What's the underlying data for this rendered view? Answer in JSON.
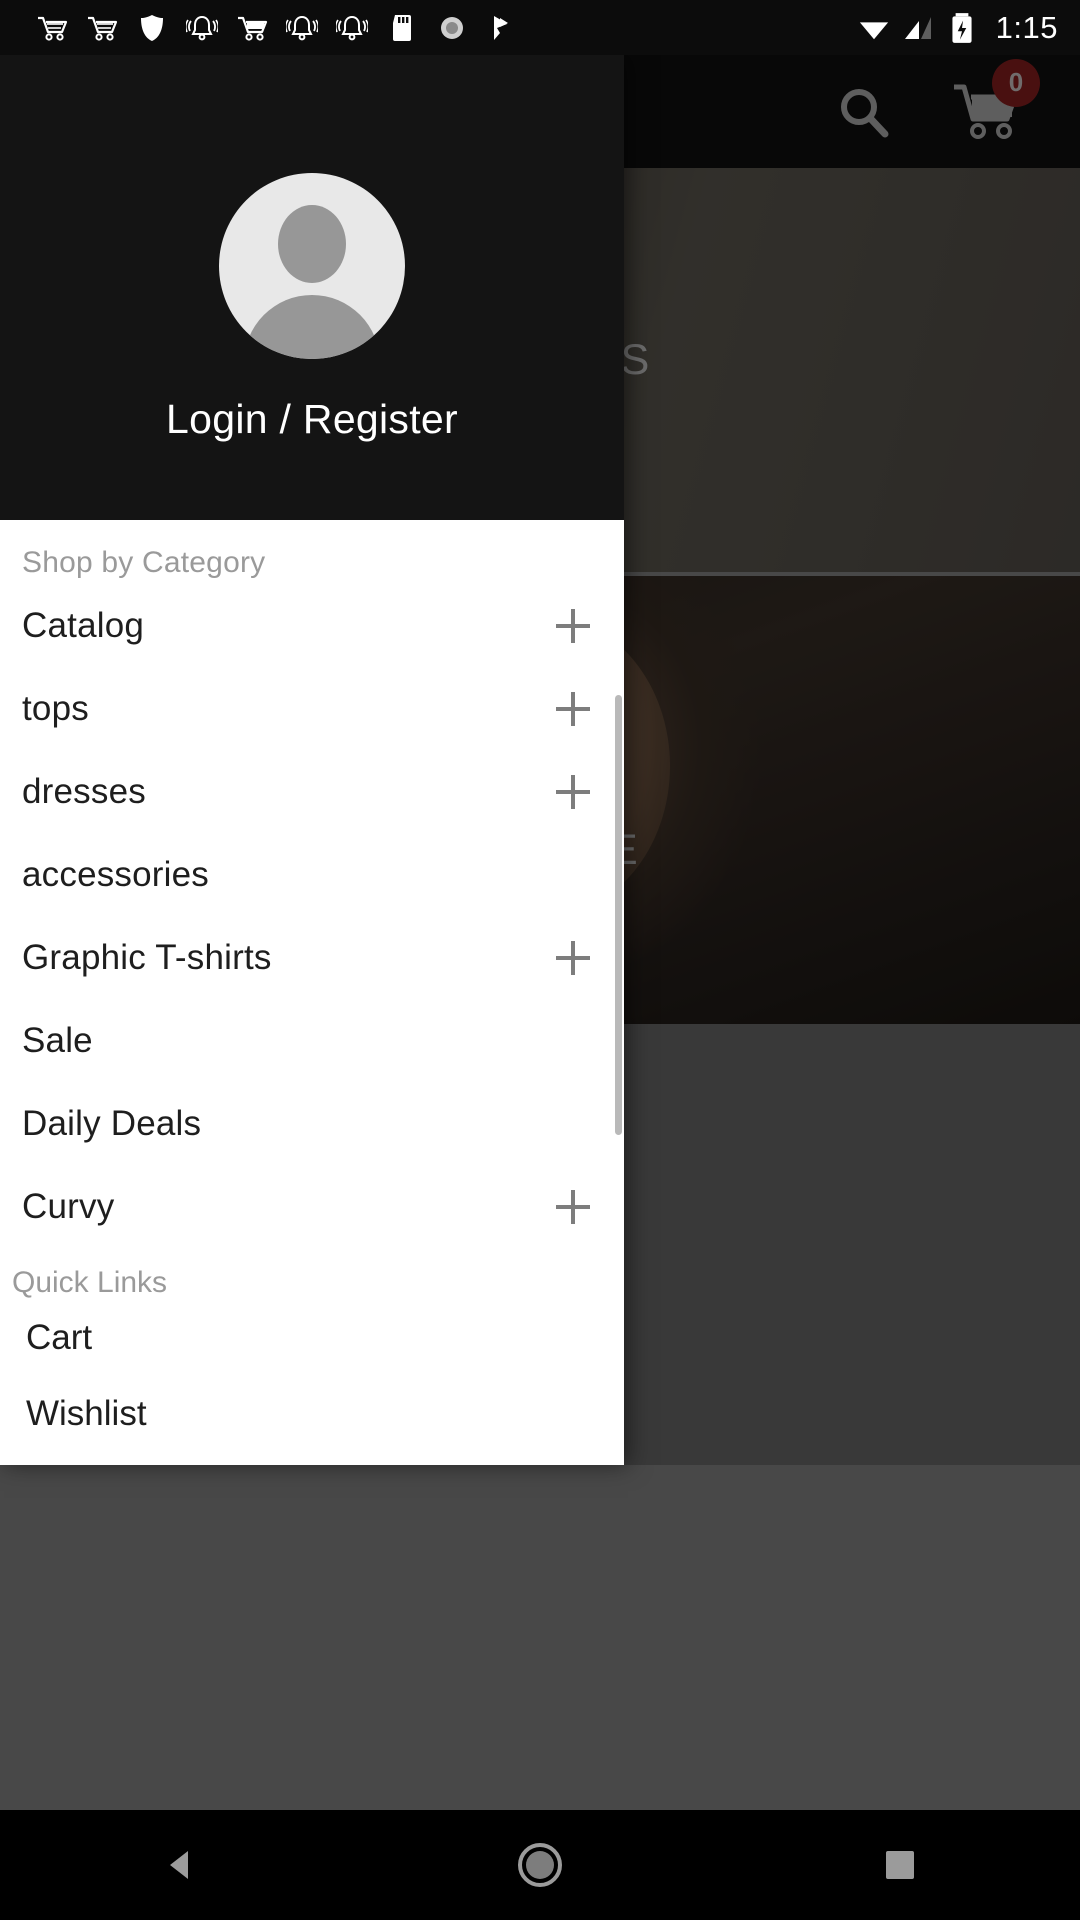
{
  "status_bar": {
    "time": "1:15",
    "left_icons": [
      {
        "name": "cart-notification-icon-1",
        "glyph": "cart"
      },
      {
        "name": "cart-notification-icon-2",
        "glyph": "cart"
      },
      {
        "name": "shield-icon",
        "glyph": "shield"
      },
      {
        "name": "alarm-ringing-icon-1",
        "glyph": "bell"
      },
      {
        "name": "cart-notification-icon-3",
        "glyph": "cart"
      },
      {
        "name": "alarm-ringing-icon-2",
        "glyph": "bell"
      },
      {
        "name": "alarm-ringing-icon-3",
        "glyph": "bell"
      },
      {
        "name": "sd-card-icon",
        "glyph": "sdcard"
      },
      {
        "name": "sync-circle-icon",
        "glyph": "sync"
      },
      {
        "name": "checkmark-flag-icon",
        "glyph": "flagcheck"
      }
    ],
    "right_icons": [
      {
        "name": "wifi-icon",
        "glyph": "wifi"
      },
      {
        "name": "cellular-signal-icon",
        "glyph": "signal"
      },
      {
        "name": "battery-charging-icon",
        "glyph": "battery"
      }
    ]
  },
  "app_bar": {
    "search_label": "search-icon",
    "cart_label": "shopping-cart-icon",
    "cart_badge_count": "0",
    "badge_color": "#8d2020"
  },
  "background_content": {
    "banner_1_caption": "ARRIVALS",
    "banner_2_caption": "T CHACE"
  },
  "drawer": {
    "account": {
      "avatar_name": "default-user-avatar",
      "login_label": "Login / Register"
    },
    "category_section": {
      "heading": "Shop by Category",
      "items": [
        {
          "label": "Catalog",
          "expandable": true
        },
        {
          "label": "tops",
          "expandable": true
        },
        {
          "label": "dresses",
          "expandable": true
        },
        {
          "label": "accessories",
          "expandable": false
        },
        {
          "label": "Graphic T-shirts",
          "expandable": true
        },
        {
          "label": "Sale",
          "expandable": false
        },
        {
          "label": "Daily Deals",
          "expandable": false
        },
        {
          "label": "Curvy",
          "expandable": true
        }
      ]
    },
    "quick_links_section": {
      "heading": "Quick Links",
      "items": [
        {
          "label": "Cart"
        },
        {
          "label": "Wishlist"
        }
      ]
    }
  },
  "nav_bar": {
    "back_label": "back-button",
    "home_label": "home-button",
    "recents_label": "recents-button"
  }
}
